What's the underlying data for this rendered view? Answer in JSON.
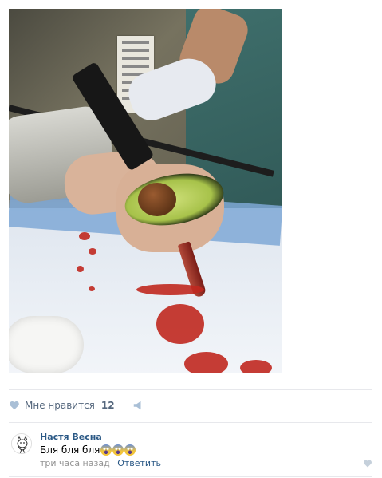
{
  "post": {
    "photo_alt": "",
    "likes": {
      "label": "Мне нравится",
      "count": "12"
    }
  },
  "comment": {
    "author": "Настя Весна",
    "text": "Бля бля бля",
    "time": "три часа назад",
    "reply_label": "Ответить"
  },
  "colors": {
    "link": "#2a5885",
    "muted": "#939393",
    "action": "#55677d",
    "divider": "#e7e8ec"
  }
}
